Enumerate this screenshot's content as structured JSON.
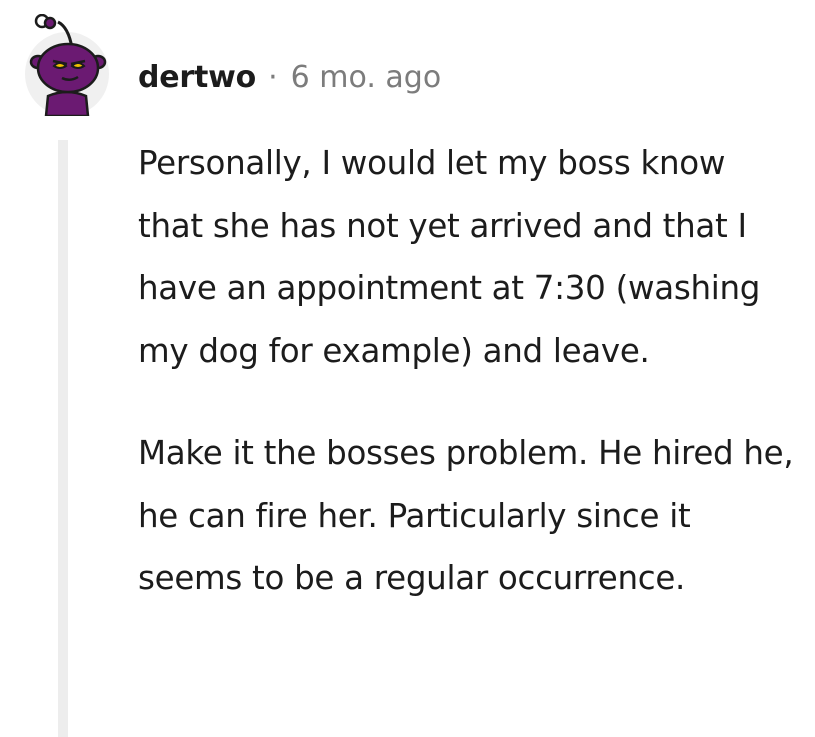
{
  "comment": {
    "username": "dertwo",
    "separator": "·",
    "timestamp": "6 mo. ago",
    "avatar_icon": "snoo-avatar-icon",
    "colors": {
      "avatar_purple": "#6b1a72",
      "text": "#1c1c1c",
      "meta": "#7c7c7c",
      "thread_line": "#ededed"
    },
    "paragraphs": [
      "Personally, I would let my boss know that she has not yet arrived and that I have an appointment at 7:30 (washing my dog for example) and leave.",
      "Make it the bosses problem. He hired he, he can fire her. Particularly since it seems to be a regular occurrence."
    ]
  }
}
